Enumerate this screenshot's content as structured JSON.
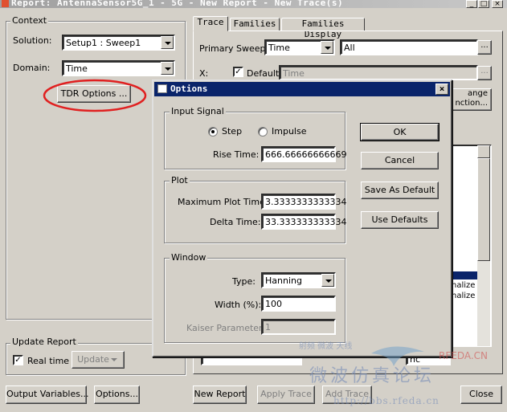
{
  "window": {
    "title": "Report: AntennaSensor5G_1 - 5G - New Report - New Trace(s)"
  },
  "context": {
    "group_label": "Context",
    "solution_label": "Solution:",
    "solution_value": "Setup1 : Sweep1",
    "domain_label": "Domain:",
    "domain_value": "Time",
    "tdr_button": "TDR Options ..."
  },
  "update_report": {
    "group_label": "Update Report",
    "realtime_label": "Real time",
    "realtime_checked": "✓",
    "update_button": "Update"
  },
  "tabs": [
    "Trace",
    "Families",
    "Families Display"
  ],
  "trace": {
    "primary_sweep_label": "Primary Sweep:",
    "primary_sweep_value": "Time",
    "primary_sweep_range": "All",
    "ellipsis": "...",
    "x_label": "X:",
    "default_label": "Default",
    "default_checked": "✓",
    "x_value": "Time",
    "range_button_partial": "ange",
    "function_button_partial": "nction...",
    "list_partial_1": "nalize",
    "list_partial_2": "nalize",
    "field_partial": "nc"
  },
  "bottom": {
    "output_variables": "Output Variables...",
    "options": "Options...",
    "new_report": "New Report",
    "apply_trace": "Apply Trace",
    "add_trace": "Add Trace",
    "close": "Close"
  },
  "options_dialog": {
    "title": "Options",
    "close_glyph": "×",
    "input_signal": {
      "label": "Input Signal",
      "step_label": "Step",
      "impulse_label": "Impulse",
      "rise_time_label": "Rise Time:",
      "rise_time_value": "666.66666666669"
    },
    "plot": {
      "label": "Plot",
      "max_plot_time_label": "Maximum Plot Time:",
      "max_plot_time_value": "3.3333333333334",
      "delta_time_label": "Delta Time:",
      "delta_time_value": "33.333333333334"
    },
    "window": {
      "label": "Window",
      "type_label": "Type:",
      "type_value": "Hanning",
      "width_label": "Width (%):",
      "width_value": "100",
      "kaiser_label": "Kaiser Parameter:",
      "kaiser_value": "1"
    },
    "buttons": {
      "ok": "OK",
      "cancel": "Cancel",
      "save_as_default": "Save As Default",
      "use_defaults": "Use Defaults"
    }
  },
  "watermark": {
    "line1": "微波仿真论坛",
    "url": "http://bbs.rfeda.cn",
    "logo": "RFEDA.CN",
    "small": "射频 微波 天线"
  },
  "colors": {
    "annotation_circle": "#e02020",
    "dialog_title_bg": "#0a246a",
    "selection": "#0a246a"
  }
}
